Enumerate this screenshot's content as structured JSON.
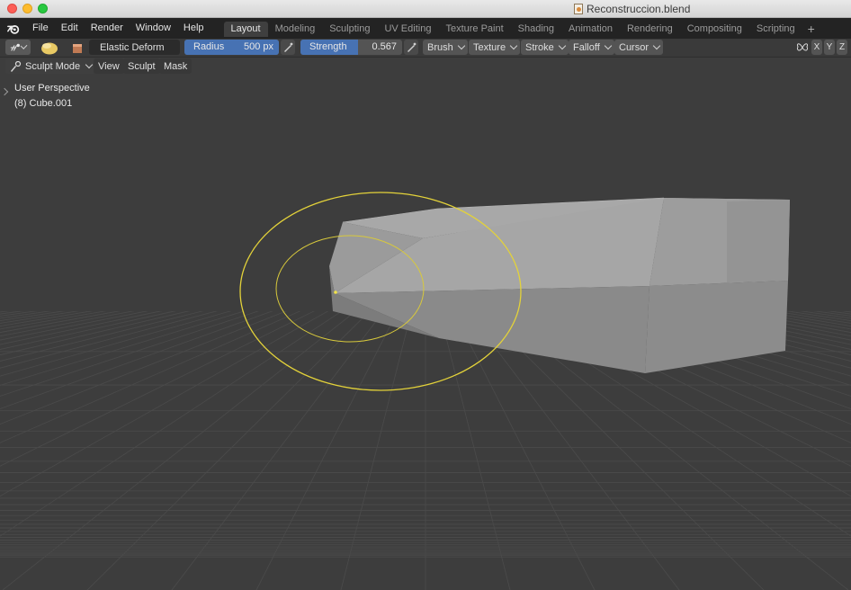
{
  "window": {
    "title": "Reconstruccion.blend"
  },
  "menu": {
    "items": [
      "File",
      "Edit",
      "Render",
      "Window",
      "Help"
    ]
  },
  "workspaces": {
    "tabs": [
      "Layout",
      "Modeling",
      "Sculpting",
      "UV Editing",
      "Texture Paint",
      "Shading",
      "Animation",
      "Rendering",
      "Compositing",
      "Scripting"
    ],
    "active": "Layout",
    "add": "+"
  },
  "tool_settings": {
    "brush_name": "Elastic Deform",
    "radius": {
      "label": "Radius",
      "value": "500 px"
    },
    "strength": {
      "label": "Strength",
      "value": "0.567",
      "fraction": 0.567
    },
    "dropdowns": [
      "Brush",
      "Texture",
      "Stroke",
      "Falloff",
      "Cursor"
    ],
    "symmetry_axes": [
      "X",
      "Y",
      "Z"
    ]
  },
  "mode_header": {
    "mode": "Sculpt Mode",
    "menus": [
      "View",
      "Sculpt",
      "Mask"
    ]
  },
  "viewport": {
    "perspective_label": "User Perspective",
    "object_label": "(8) Cube.001"
  },
  "colors": {
    "accent": "#4772b3",
    "brush_cursor": "#e3d23a",
    "viewport_bg": "#3d3d3d",
    "grid": "#4a4a4a"
  }
}
